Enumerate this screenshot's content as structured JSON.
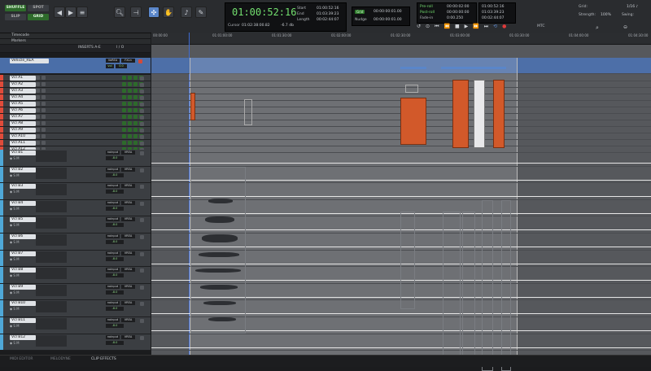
{
  "toolbar": {
    "modes": [
      "SHUFFLE",
      "SPOT",
      "SLIP",
      "GRID"
    ],
    "main_counter": "01:00:52:16",
    "cursor_label": "Cursor",
    "cursor_value": "01:02:38:00.82",
    "cursor_db": "-6.7 db",
    "start_label": "Start",
    "end_label": "End",
    "length_label": "Length",
    "start_value": "01:00:52:16",
    "end_value": "01:03:39:23",
    "length_value": "00:02:44:07",
    "grid_badge": "Grid",
    "grid_value": "00:00:00:01.00",
    "nudge_label": "Nudge",
    "nudge_value": "00:00:00:01.00",
    "preroll_label": "Pre-roll",
    "postroll_label": "Post-roll",
    "fadein_label": "Fade-in",
    "preroll_value": "00:00:02:00",
    "postroll_value": "00:00:00:00",
    "fadein_value": "0:00.250",
    "transport_values": [
      "01:00:52:16",
      "01:03:39:23",
      "00:02:44:07"
    ],
    "mtc": "MTC",
    "grid_note_label": "Grid:",
    "grid_note_value": "1/16 ♪",
    "strength_label": "Strength:",
    "strength_value": "100%",
    "swing_label": "Swing:",
    "swing_value": ""
  },
  "rulers": {
    "timecode": "Timecode",
    "markers": "Markers",
    "header_inserts": "INSERTS A-E",
    "header_io": "I / O",
    "ticks": [
      "00:00:00",
      "01:01:00:00",
      "01:01:30:00",
      "01:02:00:00",
      "01:02:30:00",
      "01:03:00:00",
      "01:03:30:00",
      "01:04:00:00",
      "01:04:30:00"
    ]
  },
  "vehicle_track": {
    "name": "Vehicle_REA",
    "io": "VoREA",
    "io2": "FXLn",
    "vol": "vol",
    "vol_value": "0.0"
  },
  "tracks_a": [
    "Vcl A1",
    "Vcl A2",
    "Vcl A3",
    "Vcl A4",
    "Vcl A5",
    "Vcl A6",
    "Vcl A7",
    "Vcl A8",
    "Vcl A9",
    "Vcl A10",
    "Vcl A11",
    "Vcl A12"
  ],
  "tracks_b": [
    "Vcl B1",
    "Vcl B2",
    "Vcl B3",
    "Vcl B4",
    "Vcl B5",
    "Vcl B6",
    "Vcl B7",
    "Vcl B8",
    "Vcl B9",
    "Vcl B10",
    "Vcl B11",
    "Vcl B12"
  ],
  "track_b_io": "noinput",
  "track_b_out": "VREA",
  "track_b_vol": "-8.0",
  "bottom_tabs": [
    "MIDI EDITOR",
    "MELODYNE",
    "CLIP EFFECTS"
  ],
  "colors": {
    "accent_blue": "#5a86c9",
    "clip_orange": "#d2592a",
    "timecode_green": "#73e06f"
  }
}
